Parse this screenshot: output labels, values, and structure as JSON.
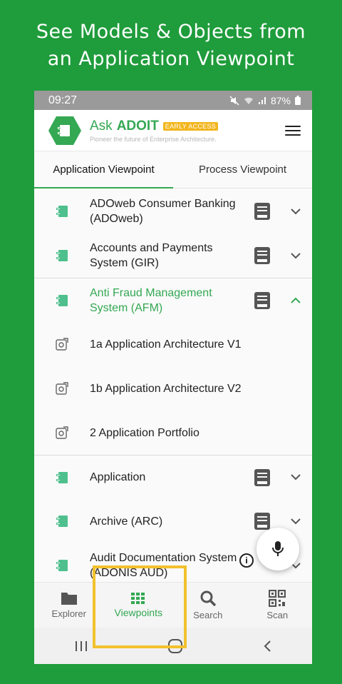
{
  "promo": {
    "line1": "See Models & Objects from",
    "line2": "an Application Viewpoint"
  },
  "status": {
    "time": "09:27",
    "battery": "87%",
    "icons": [
      "mute-icon",
      "wifi-icon",
      "signal-icon",
      "battery-icon"
    ]
  },
  "app": {
    "brand_ask": "Ask",
    "brand_name": "ADOIT",
    "badge": "EARLY ACCESS",
    "tagline": "Pioneer the future of Enterprise Architecture."
  },
  "tabs": [
    {
      "label": "Application Viewpoint",
      "active": true
    },
    {
      "label": "Process Viewpoint",
      "active": false
    }
  ],
  "list": {
    "items": [
      {
        "label": "ADOweb Consumer Banking (ADOweb)"
      },
      {
        "label": "Accounts and Payments System (GIR)"
      },
      {
        "label": "Anti Fraud Management System (AFM)",
        "expanded": true
      },
      {
        "label": "1a Application Architecture V1",
        "sub": true
      },
      {
        "label": "1b Application Architecture V2",
        "sub": true
      },
      {
        "label": "2 Application Portfolio",
        "sub": true
      },
      {
        "label": "Application"
      },
      {
        "label": "Archive (ARC)"
      },
      {
        "label": "Audit Documentation System (ADONIS AUD)"
      }
    ]
  },
  "info_label": "i",
  "bottom_nav": [
    {
      "label": "Explorer",
      "icon": "folder-icon"
    },
    {
      "label": "Viewpoints",
      "icon": "grid-icon",
      "active": true
    },
    {
      "label": "Search",
      "icon": "search-icon"
    },
    {
      "label": "Scan",
      "icon": "qr-code-icon"
    }
  ],
  "colors": {
    "background": "#1f9c3b",
    "accent": "#34a853",
    "badge": "#f2b51c",
    "highlight": "#f2c12e"
  }
}
